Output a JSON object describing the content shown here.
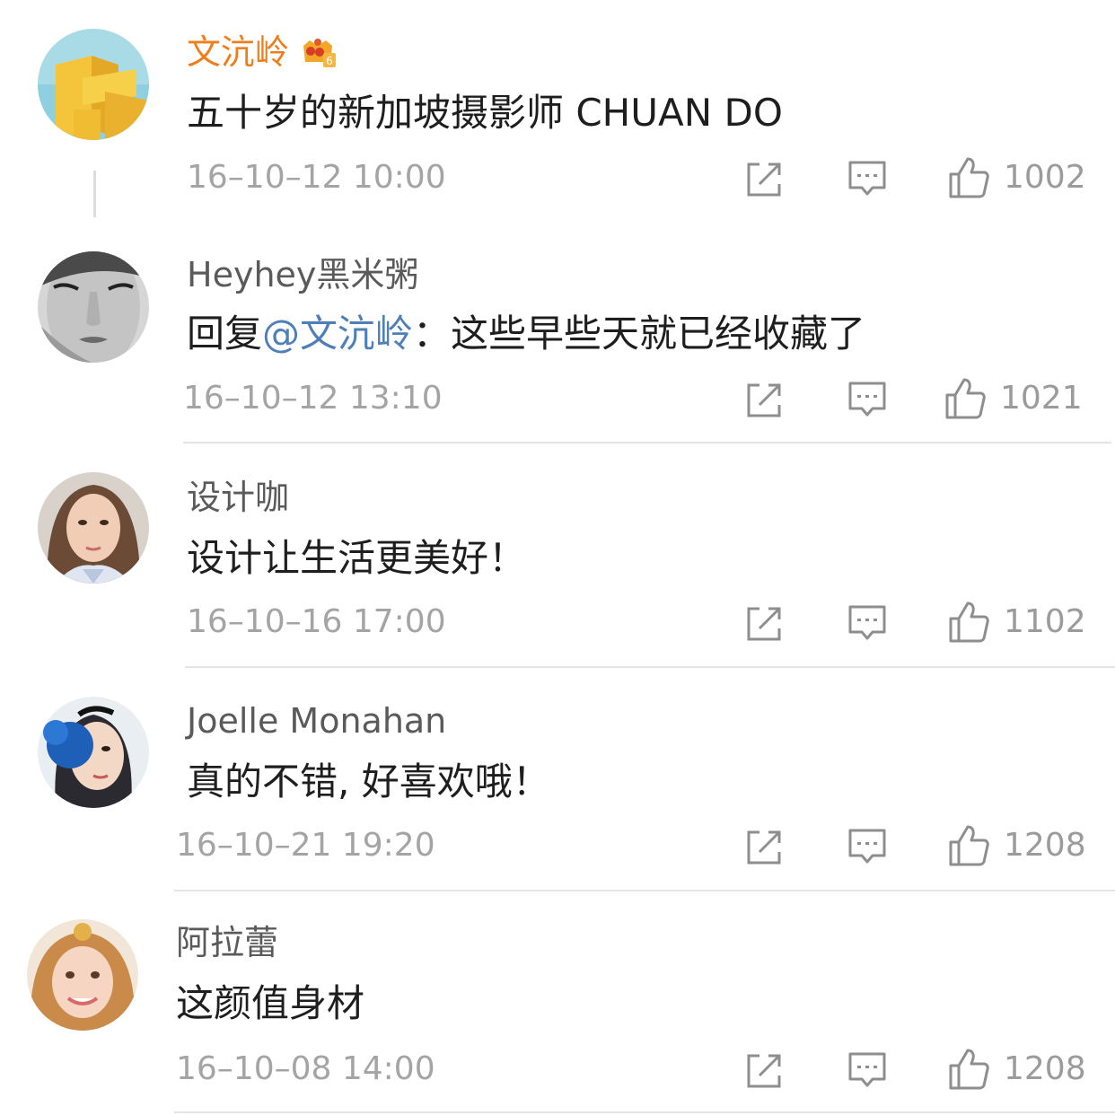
{
  "comments": [
    {
      "author": "文沆岭",
      "is_vip": true,
      "vip_level": "6",
      "text": "五十岁的新加坡摄影师 CHUAN DO",
      "time": "16–10–12 10:00",
      "likes": "1002"
    },
    {
      "author": "Heyhey黑米粥",
      "is_vip": false,
      "reply_prefix": "回复",
      "mention": "@文沆岭",
      "reply_text": "：这些早些天就已经收藏了",
      "time": "16–10–12 13:10",
      "likes": "1021"
    },
    {
      "author": "设计咖",
      "is_vip": false,
      "text": "设计让生活更美好！",
      "time": "16–10–16 17:00",
      "likes": "1102"
    },
    {
      "author": "Joelle Monahan",
      "is_vip": false,
      "text": "真的不错, 好喜欢哦！",
      "time": "16–10–21 19:20",
      "likes": "1208"
    },
    {
      "author": "阿拉蕾",
      "is_vip": false,
      "text": "这颜值身材",
      "time": "16–10–08 14:00",
      "likes": "1208"
    }
  ],
  "icons": {
    "forward": "forward-icon",
    "comment": "comment-icon",
    "like": "thumbs-up-icon",
    "crown": "crown-icon"
  },
  "colors": {
    "vip_name": "#ef7d1a",
    "mention": "#4f7fb8",
    "name": "#5a5a5a",
    "text": "#1e1e1e",
    "meta": "#a4a4a4"
  }
}
